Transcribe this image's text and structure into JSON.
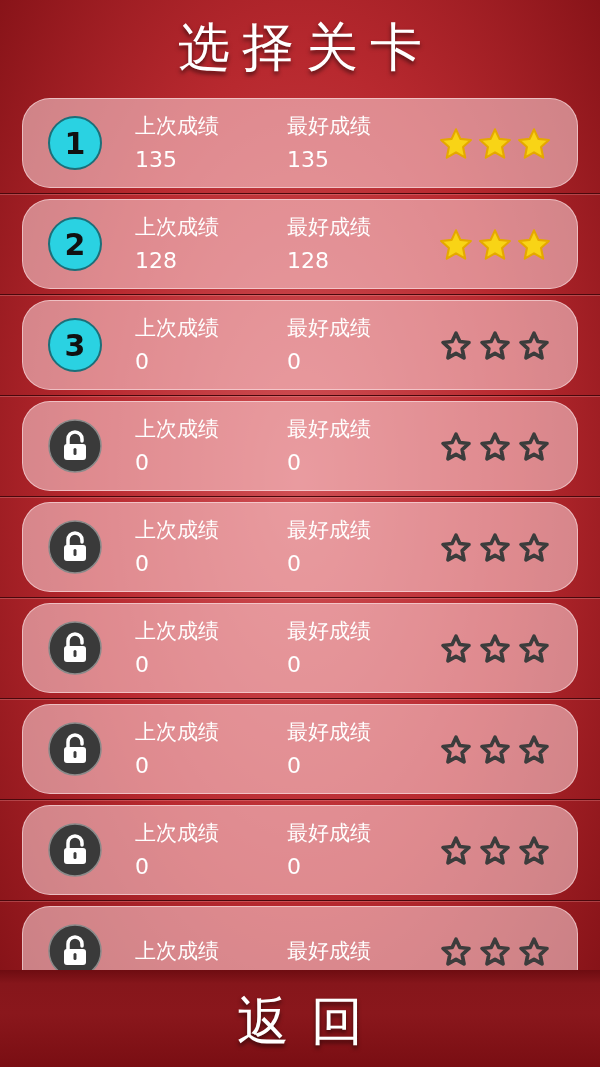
{
  "title": "选择关卡",
  "levels": [
    {
      "locked": false,
      "number": "1",
      "last_label": "上次成绩",
      "last_score": "135",
      "best_label": "最好成绩",
      "best_score": "135",
      "stars": 3
    },
    {
      "locked": false,
      "number": "2",
      "last_label": "上次成绩",
      "last_score": "128",
      "best_label": "最好成绩",
      "best_score": "128",
      "stars": 3
    },
    {
      "locked": false,
      "number": "3",
      "last_label": "上次成绩",
      "last_score": "0",
      "best_label": "最好成绩",
      "best_score": "0",
      "stars": 0
    },
    {
      "locked": true,
      "last_label": "上次成绩",
      "last_score": "0",
      "best_label": "最好成绩",
      "best_score": "0",
      "stars": 0
    },
    {
      "locked": true,
      "last_label": "上次成绩",
      "last_score": "0",
      "best_label": "最好成绩",
      "best_score": "0",
      "stars": 0
    },
    {
      "locked": true,
      "last_label": "上次成绩",
      "last_score": "0",
      "best_label": "最好成绩",
      "best_score": "0",
      "stars": 0
    },
    {
      "locked": true,
      "last_label": "上次成绩",
      "last_score": "0",
      "best_label": "最好成绩",
      "best_score": "0",
      "stars": 0
    },
    {
      "locked": true,
      "last_label": "上次成绩",
      "last_score": "0",
      "best_label": "最好成绩",
      "best_score": "0",
      "stars": 0
    },
    {
      "locked": true,
      "last_label": "上次成绩",
      "best_label": "最好成绩",
      "stars": 0
    }
  ],
  "back_button": "返回"
}
